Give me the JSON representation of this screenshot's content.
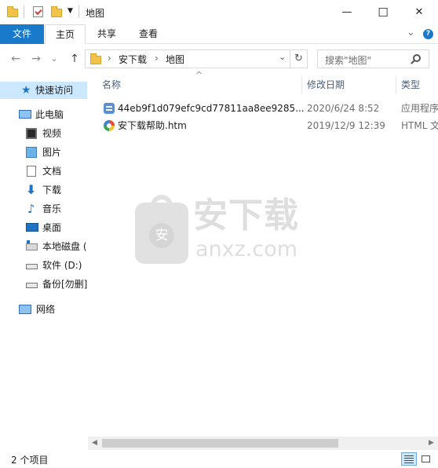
{
  "window": {
    "title": "地图",
    "minimize": "—",
    "maximize": "☐",
    "close": "✕"
  },
  "ribbon": {
    "tabs": [
      "文件",
      "主页",
      "共享",
      "查看"
    ],
    "expand": "⌄",
    "help": "?"
  },
  "address": {
    "back": "←",
    "forward": "→",
    "recent": "⌄",
    "up": "↑",
    "crumbs": [
      "安下载",
      "地图"
    ],
    "sep": "›",
    "dropdown": "⌄",
    "refresh": "↻",
    "search_placeholder": "搜索\"地图\""
  },
  "navpane": {
    "quick_access": "快速访问",
    "this_pc": "此电脑",
    "items": [
      {
        "label": "视频",
        "icon": "video-icon"
      },
      {
        "label": "图片",
        "icon": "picture-icon"
      },
      {
        "label": "文档",
        "icon": "document-icon"
      },
      {
        "label": "下载",
        "icon": "download-icon"
      },
      {
        "label": "音乐",
        "icon": "music-icon"
      },
      {
        "label": "桌面",
        "icon": "desktop-icon"
      },
      {
        "label": "本地磁盘 (",
        "icon": "disk-icon"
      },
      {
        "label": "软件 (D:)",
        "icon": "drive-icon"
      },
      {
        "label": "备份[勿删]",
        "icon": "drive-icon"
      }
    ],
    "network": "网络"
  },
  "columns": {
    "name": "名称",
    "modified": "修改日期",
    "type": "类型",
    "sort_arrow": "^"
  },
  "files": [
    {
      "name": "44eb9f1d079efc9cd77811aa8ee9285...",
      "modified": "2020/6/24 8:52",
      "type": "应用程序",
      "icon": "exe-icon"
    },
    {
      "name": "安下载帮助.htm",
      "modified": "2019/12/9 12:39",
      "type": "HTML 文",
      "icon": "html-icon"
    }
  ],
  "watermark": {
    "text": "安下载",
    "sub": "anxz.com",
    "badge": "安"
  },
  "status": {
    "count": "2 个项目"
  },
  "colors": {
    "accent": "#1979ca",
    "selected_nav": "#cce8ff"
  }
}
